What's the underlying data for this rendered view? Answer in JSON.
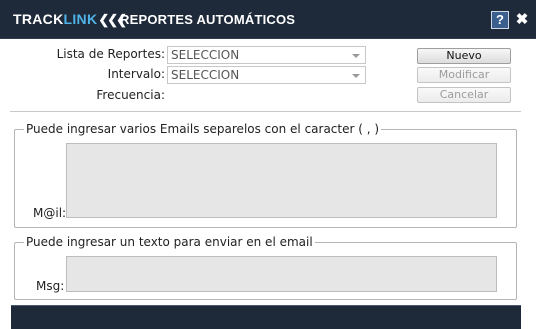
{
  "header": {
    "brand_part1": "TRACK",
    "brand_part2": "LINK",
    "brand_arrows": "❮❮❮",
    "title": "REPORTES AUTOMÁTICOS",
    "help_label": "?",
    "close_label": "✖"
  },
  "form": {
    "lista_label": "Lista de Reportes:",
    "lista_value": "SELECCION",
    "intervalo_label": "Intervalo:",
    "intervalo_value": "SELECCION",
    "frecuencia_label": "Frecuencia:"
  },
  "buttons": {
    "nuevo": "Nuevo",
    "modificar": "Modificar",
    "cancelar": "Cancelar"
  },
  "emails": {
    "legend": "Puede ingresar varios Emails separelos con el caracter ( , )",
    "label": "M@il:",
    "value": ""
  },
  "message": {
    "legend": "Puede ingresar un texto para enviar en el email",
    "label": "Msg:",
    "value": ""
  },
  "colors": {
    "titlebar": "#1e2a3a",
    "brand_accent": "#4fb3e8",
    "textarea_bg": "#e6e6e6"
  }
}
